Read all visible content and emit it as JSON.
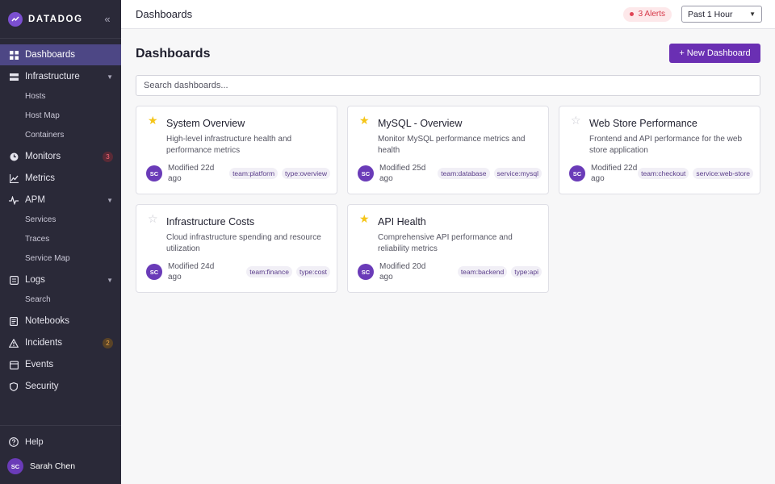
{
  "brand": {
    "name": "DATADOG",
    "collapse_icon": "«"
  },
  "sidebar": {
    "items": [
      {
        "label": "Dashboards",
        "icon": "grid-icon",
        "active": true
      },
      {
        "label": "Infrastructure",
        "icon": "server-icon",
        "caret": "▼",
        "children": [
          "Hosts",
          "Host Map",
          "Containers"
        ]
      },
      {
        "label": "Monitors",
        "icon": "monitor-icon",
        "badge": "3"
      },
      {
        "label": "Metrics",
        "icon": "chart-icon"
      },
      {
        "label": "APM",
        "icon": "pulse-icon",
        "caret": "▼",
        "children": [
          "Services",
          "Traces",
          "Service Map"
        ]
      },
      {
        "label": "Logs",
        "icon": "logs-icon",
        "caret": "▼",
        "children": [
          "Search"
        ]
      },
      {
        "label": "Notebooks",
        "icon": "notebook-icon"
      },
      {
        "label": "Incidents",
        "icon": "warning-icon",
        "badge": "2"
      },
      {
        "label": "Events",
        "icon": "events-icon"
      },
      {
        "label": "Security",
        "icon": "shield-icon"
      }
    ],
    "help_label": "Help",
    "user": {
      "initials": "SC",
      "name": "Sarah Chen"
    }
  },
  "topbar": {
    "title": "Dashboards",
    "alerts_label": "3 Alerts",
    "time_range": "Past 1 Hour"
  },
  "main": {
    "title": "Dashboards",
    "new_button": "+ New Dashboard",
    "search_placeholder": "Search dashboards...",
    "cards": [
      {
        "title": "System Overview",
        "starred": true,
        "desc": "High-level infrastructure health and performance metrics",
        "initials": "SC",
        "modified": "Modified 22d ago",
        "tags": [
          "team:platform",
          "type:overview"
        ]
      },
      {
        "title": "MySQL - Overview",
        "starred": true,
        "desc": "Monitor MySQL performance metrics and health",
        "initials": "SC",
        "modified": "Modified 25d ago",
        "tags": [
          "team:database",
          "service:mysql"
        ]
      },
      {
        "title": "Web Store Performance",
        "starred": false,
        "desc": "Frontend and API performance for the web store application",
        "initials": "SC",
        "modified": "Modified 22d ago",
        "tags": [
          "team:checkout",
          "service:web-store"
        ]
      },
      {
        "title": "Infrastructure Costs",
        "starred": false,
        "desc": "Cloud infrastructure spending and resource utilization",
        "initials": "SC",
        "modified": "Modified 24d ago",
        "tags": [
          "team:finance",
          "type:cost"
        ]
      },
      {
        "title": "API Health",
        "starred": true,
        "desc": "Comprehensive API performance and reliability metrics",
        "initials": "SC",
        "modified": "Modified 20d ago",
        "tags": [
          "team:backend",
          "type:api"
        ]
      }
    ]
  },
  "colors": {
    "accent": "#6a2fb3",
    "sidebar_bg": "#2a2938",
    "active_nav": "#4d4785",
    "star": "#f5c518"
  }
}
